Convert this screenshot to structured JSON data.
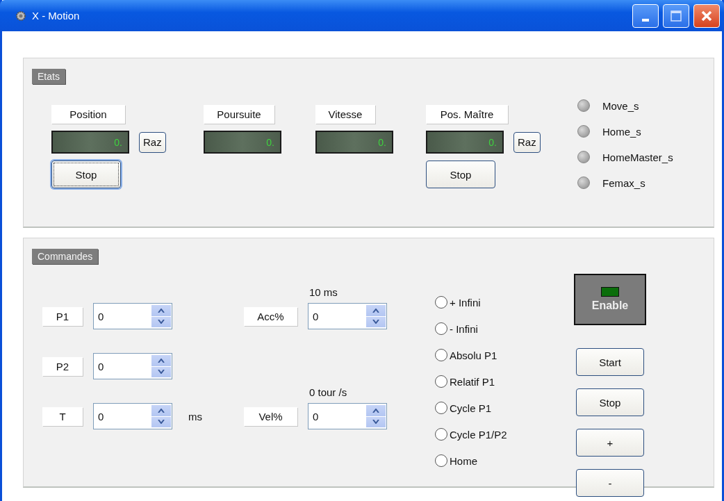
{
  "window": {
    "title": "X - Motion"
  },
  "etats": {
    "title": "Etats",
    "channels": [
      {
        "label": "Position",
        "value": "0.",
        "raz": "Raz",
        "stop": {
          "label": "Stop",
          "focused": true
        }
      },
      {
        "label": "Poursuite",
        "value": "0."
      },
      {
        "label": "Vitesse",
        "value": "0."
      },
      {
        "label": "Pos. Maître",
        "value": "0.",
        "raz": "Raz",
        "stop": {
          "label": "Stop",
          "focused": false
        }
      }
    ],
    "leds": [
      {
        "label": "Move_s",
        "on": false
      },
      {
        "label": "Home_s",
        "on": false
      },
      {
        "label": "HomeMaster_s",
        "on": false
      },
      {
        "label": "Femax_s",
        "on": false
      }
    ]
  },
  "commandes": {
    "title": "Commandes",
    "rows": [
      {
        "left": {
          "label": "P1",
          "value": "0"
        },
        "right": {
          "label": "Acc%",
          "value": "0",
          "caption": "10 ms"
        }
      },
      {
        "left": {
          "label": "P2",
          "value": "0"
        }
      },
      {
        "left": {
          "label": "T",
          "value": "0",
          "unit": "ms"
        },
        "right": {
          "label": "Vel%",
          "value": "0",
          "caption": "0 tour /s"
        }
      }
    ],
    "modes": [
      {
        "label": "+ Infini",
        "selected": false
      },
      {
        "label": "- Infini",
        "selected": false
      },
      {
        "label": "Absolu P1",
        "selected": false
      },
      {
        "label": "Relatif P1",
        "selected": false
      },
      {
        "label": "Cycle P1",
        "selected": false
      },
      {
        "label": "Cycle P1/P2",
        "selected": false
      },
      {
        "label": "Home",
        "selected": false
      }
    ],
    "enable": {
      "label": "Enable",
      "on": false
    },
    "buttons": [
      "Start",
      "Stop",
      "+",
      "-"
    ]
  }
}
